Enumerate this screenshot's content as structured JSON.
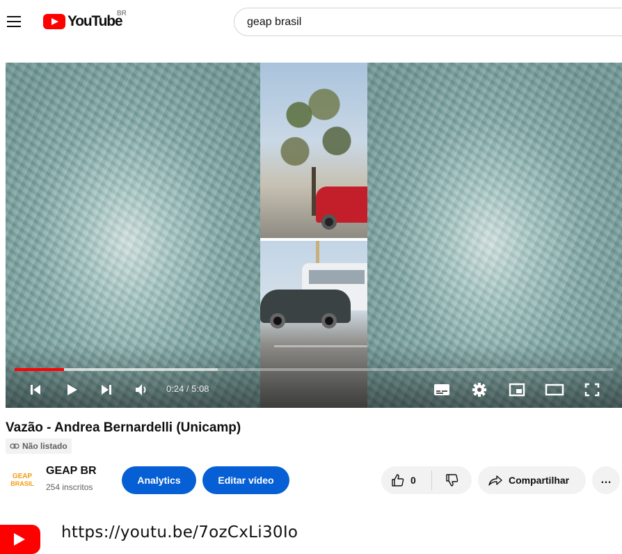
{
  "masthead": {
    "logo_text": "YouTube",
    "region": "BR",
    "search_value": "geap brasil"
  },
  "player": {
    "time": "0:24 / 5:08",
    "progress_played": 0.082,
    "progress_buffered": 0.34
  },
  "video": {
    "title": "Vazão - Andrea Bernardelli (Unicamp)",
    "visibility": "Não listado"
  },
  "channel": {
    "logo_line1": "GEAP",
    "logo_line2": "BRASIL",
    "name": "GEAP BR",
    "subscribers": "254 inscritos"
  },
  "actions": {
    "analytics": "Analytics",
    "edit": "Editar vídeo",
    "likes": "0",
    "share": "Compartilhar",
    "more": "…"
  },
  "overlay": {
    "url": "https://youtu.be/7ozCxLi30Io"
  },
  "colors": {
    "brand_red": "#ff0000",
    "accent_blue": "#065fd4"
  }
}
